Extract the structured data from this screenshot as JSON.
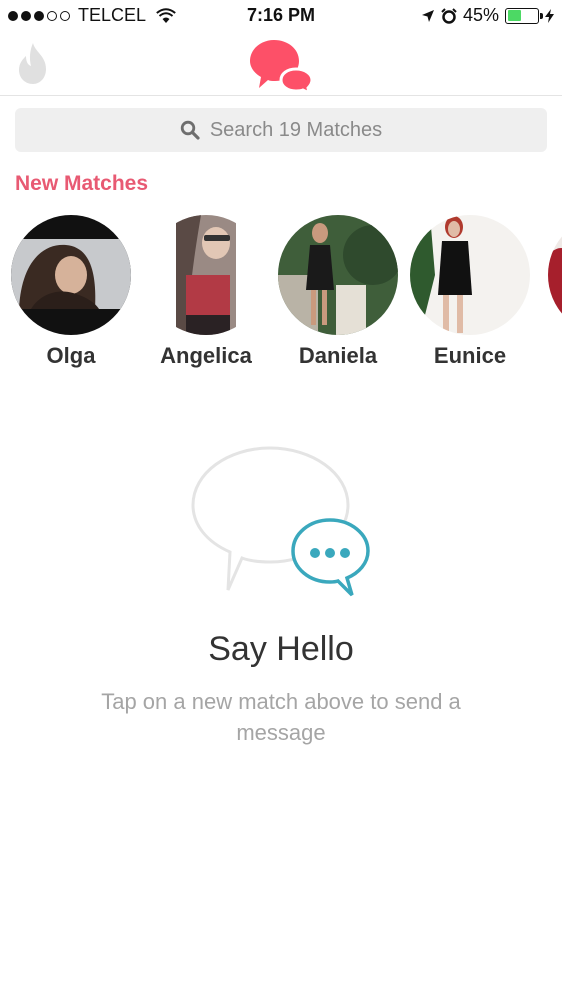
{
  "status_bar": {
    "carrier": "TELCEL",
    "time": "7:16 PM",
    "battery_percent": "45%",
    "battery_level": 0.45,
    "signal_bars_filled": 3,
    "signal_bars_total": 5
  },
  "header": {
    "left_icon": "flame-icon",
    "center_icon": "chat-bubbles-icon",
    "accent_color": "#fd5068"
  },
  "search": {
    "placeholder": "Search 19 Matches",
    "icon": "search-icon"
  },
  "new_matches": {
    "title": "New Matches",
    "items": [
      {
        "name": "Olga"
      },
      {
        "name": "Angelica"
      },
      {
        "name": "Daniela"
      },
      {
        "name": "Eunice"
      },
      {
        "name": ""
      }
    ]
  },
  "empty_state": {
    "title": "Say Hello",
    "message": "Tap on a new match above to send a message",
    "accent_color": "#3aa8bd"
  }
}
